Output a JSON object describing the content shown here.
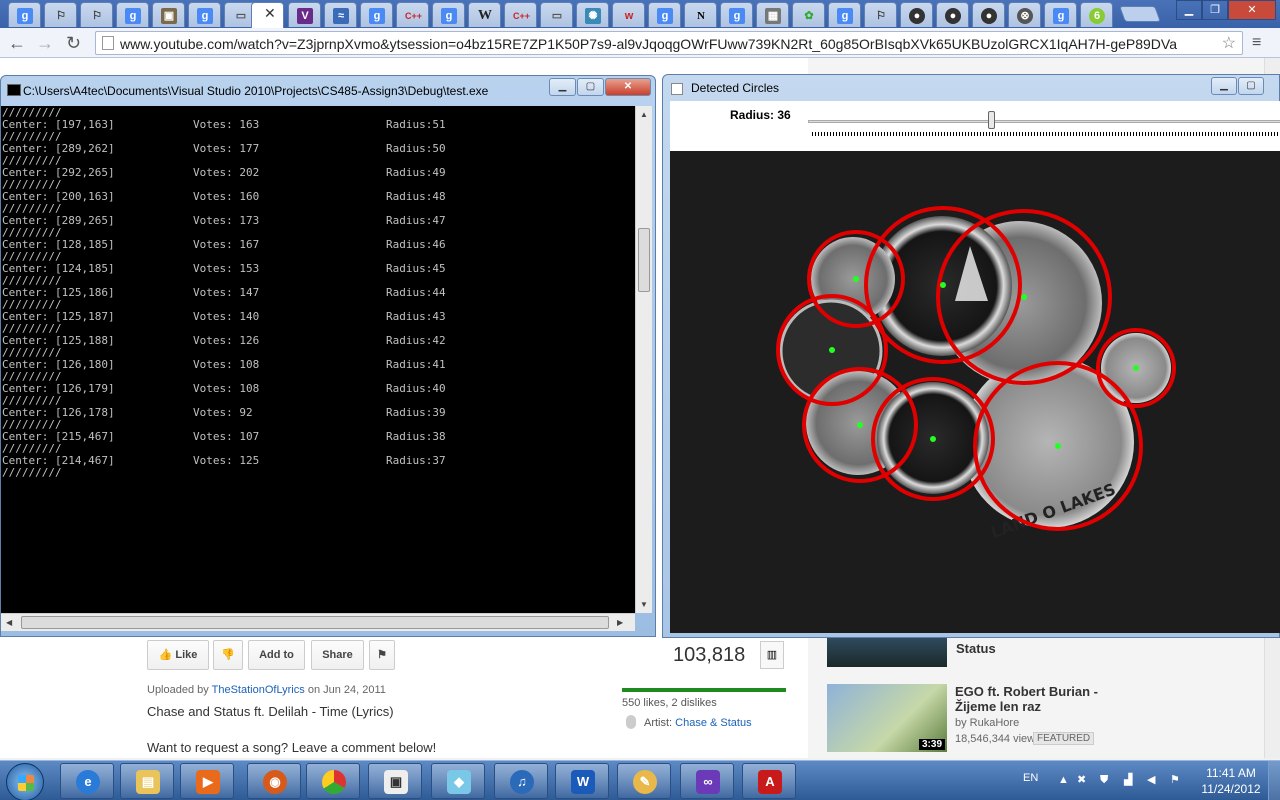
{
  "browser": {
    "url_text": "www.youtube.com/watch?v=Z3jprnpXvmo&ytsession=o4bz15RE7ZP1K50P7s9-al9vJqoqgOWrFUww739KN2Rt_60g85OrBIsqbXVk65UKBUzolGRCX1IqAH7H-geP89DVa"
  },
  "console": {
    "title": "C:\\Users\\A4tec\\Documents\\Visual Studio 2010\\Projects\\CS485-Assign3\\Debug\\test.exe",
    "separator": "/////////",
    "rows": [
      {
        "center": "Center: [197,163]",
        "votes": "Votes: 163",
        "radius": "Radius:51"
      },
      {
        "center": "Center: [289,262]",
        "votes": "Votes: 177",
        "radius": "Radius:50"
      },
      {
        "center": "Center: [292,265]",
        "votes": "Votes: 202",
        "radius": "Radius:49"
      },
      {
        "center": "Center: [200,163]",
        "votes": "Votes: 160",
        "radius": "Radius:48"
      },
      {
        "center": "Center: [289,265]",
        "votes": "Votes: 173",
        "radius": "Radius:47"
      },
      {
        "center": "Center: [128,185]",
        "votes": "Votes: 167",
        "radius": "Radius:46"
      },
      {
        "center": "Center: [124,185]",
        "votes": "Votes: 153",
        "radius": "Radius:45"
      },
      {
        "center": "Center: [125,186]",
        "votes": "Votes: 147",
        "radius": "Radius:44"
      },
      {
        "center": "Center: [125,187]",
        "votes": "Votes: 140",
        "radius": "Radius:43"
      },
      {
        "center": "Center: [125,188]",
        "votes": "Votes: 126",
        "radius": "Radius:42"
      },
      {
        "center": "Center: [126,180]",
        "votes": "Votes: 108",
        "radius": "Radius:41"
      },
      {
        "center": "Center: [126,179]",
        "votes": "Votes: 108",
        "radius": "Radius:40"
      },
      {
        "center": "Center: [126,178]",
        "votes": "Votes: 92",
        "radius": "Radius:39"
      },
      {
        "center": "Center: [215,467]",
        "votes": "Votes: 107",
        "radius": "Radius:38"
      },
      {
        "center": "Center: [214,467]",
        "votes": "Votes: 125",
        "radius": "Radius:37"
      }
    ]
  },
  "detect_window": {
    "title": "Detected Circles",
    "radius_label": "Radius: 36",
    "coin_label": "LAND O LAKES"
  },
  "youtube": {
    "like": "Like",
    "add_to": "Add to",
    "share": "Share",
    "views": "103,818",
    "likes_text": "550 likes, 2 dislikes",
    "artist_prefix": "Artist: ",
    "artist": "Chase & Status",
    "uploaded_prefix": "Uploaded by ",
    "uploader": "TheStationOfLyrics",
    "uploaded_date": " on Jun 24, 2011",
    "video_title": "Chase and Status ft. Delilah - Time (Lyrics)",
    "description": "Want to request a song? Leave a comment below!",
    "side1_title": "Status",
    "side2_title": "EGO ft. Robert Burian - Žijeme len raz",
    "side2_by": "by RukaHore",
    "side2_views": "18,546,344 views",
    "side2_badge": "FEATURED",
    "side2_duration": "3:39"
  },
  "taskbar": {
    "lang": "EN",
    "time": "11:41 AM",
    "date": "11/24/2012"
  },
  "colors": {
    "circle": "#e00000",
    "center_dot": "#22ff22"
  }
}
